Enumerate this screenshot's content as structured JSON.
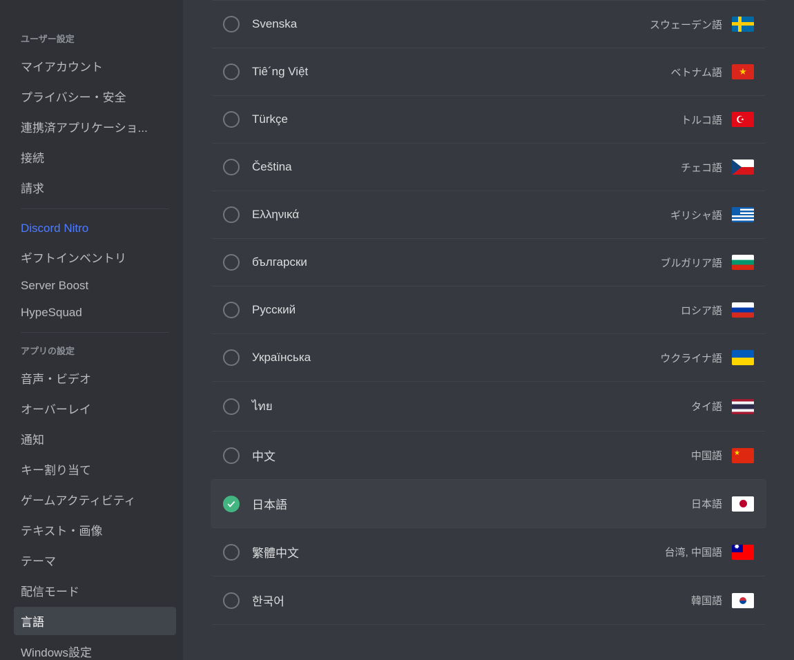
{
  "sidebar": {
    "sections": [
      {
        "header": "ユーザー設定",
        "items": [
          {
            "label": "マイアカウント",
            "key": "my-account"
          },
          {
            "label": "プライバシー・安全",
            "key": "privacy"
          },
          {
            "label": "連携済アプリケーショ...",
            "key": "authorized-apps"
          },
          {
            "label": "接続",
            "key": "connections"
          },
          {
            "label": "請求",
            "key": "billing"
          }
        ]
      },
      {
        "header": "",
        "items": [
          {
            "label": "Discord Nitro",
            "key": "nitro",
            "nitro": true
          },
          {
            "label": "ギフトインベントリ",
            "key": "gift-inventory"
          },
          {
            "label": "Server Boost",
            "key": "server-boost"
          },
          {
            "label": "HypeSquad",
            "key": "hypesquad"
          }
        ]
      },
      {
        "header": "アプリの設定",
        "items": [
          {
            "label": "音声・ビデオ",
            "key": "voice-video"
          },
          {
            "label": "オーバーレイ",
            "key": "overlay"
          },
          {
            "label": "通知",
            "key": "notifications"
          },
          {
            "label": "キー割り当て",
            "key": "keybinds"
          },
          {
            "label": "ゲームアクティビティ",
            "key": "game-activity"
          },
          {
            "label": "テキスト・画像",
            "key": "text-images"
          },
          {
            "label": "テーマ",
            "key": "appearance"
          },
          {
            "label": "配信モード",
            "key": "streamer-mode"
          },
          {
            "label": "言語",
            "key": "language",
            "active": true
          },
          {
            "label": "Windows設定",
            "key": "windows-settings"
          }
        ]
      }
    ]
  },
  "languages": [
    {
      "native": "Svenska",
      "local": "スウェーデン語",
      "flag": "se",
      "selected": false
    },
    {
      "native": "Tiê´ng Việt",
      "local": "ベトナム語",
      "flag": "vn",
      "selected": false
    },
    {
      "native": "Türkçe",
      "local": "トルコ語",
      "flag": "tr",
      "selected": false
    },
    {
      "native": "Čeština",
      "local": "チェコ語",
      "flag": "cz",
      "selected": false
    },
    {
      "native": "Ελληνικά",
      "local": "ギリシャ語",
      "flag": "gr",
      "selected": false
    },
    {
      "native": "български",
      "local": "ブルガリア語",
      "flag": "bg",
      "selected": false
    },
    {
      "native": "Pусский",
      "local": "ロシア語",
      "flag": "ru",
      "selected": false
    },
    {
      "native": "Українська",
      "local": "ウクライナ語",
      "flag": "ua",
      "selected": false
    },
    {
      "native": "ไทย",
      "local": "タイ語",
      "flag": "th",
      "selected": false
    },
    {
      "native": "中文",
      "local": "中国語",
      "flag": "cn",
      "selected": false
    },
    {
      "native": "日本語",
      "local": "日本語",
      "flag": "jp",
      "selected": true
    },
    {
      "native": "繁體中文",
      "local": "台湾, 中国語",
      "flag": "tw",
      "selected": false
    },
    {
      "native": "한국어",
      "local": "韓国語",
      "flag": "kr",
      "selected": false
    }
  ]
}
